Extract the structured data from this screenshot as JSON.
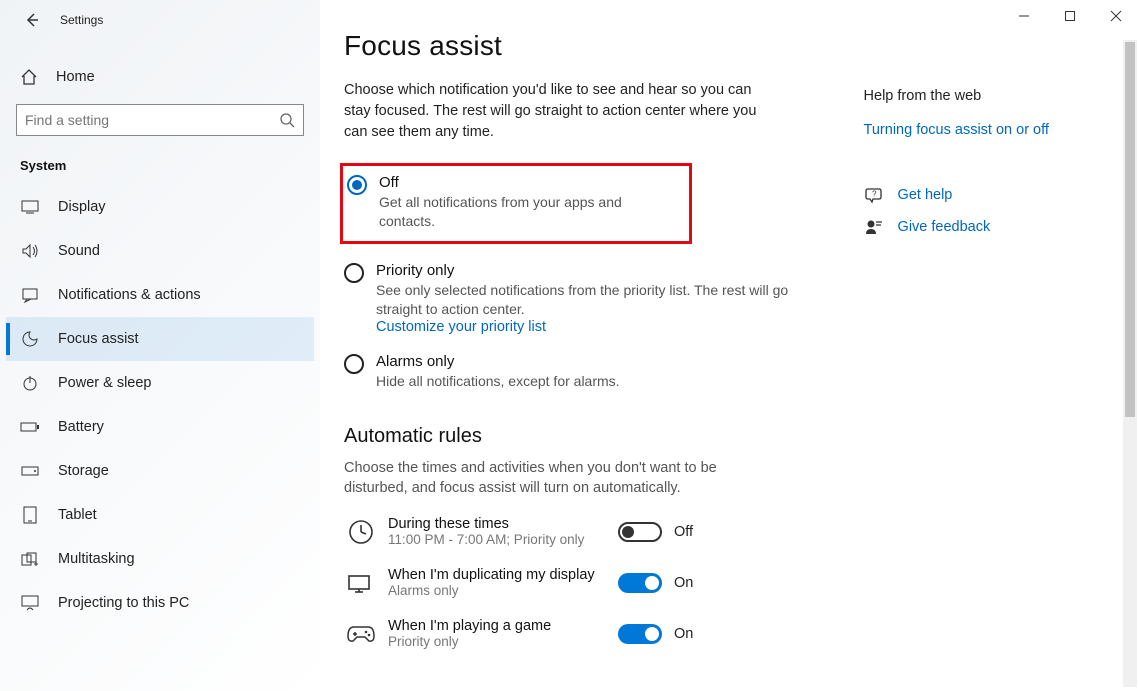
{
  "window": {
    "title": "Settings"
  },
  "sidebar": {
    "home": "Home",
    "search_placeholder": "Find a setting",
    "category": "System",
    "items": [
      {
        "label": "Display"
      },
      {
        "label": "Sound"
      },
      {
        "label": "Notifications & actions"
      },
      {
        "label": "Focus assist"
      },
      {
        "label": "Power & sleep"
      },
      {
        "label": "Battery"
      },
      {
        "label": "Storage"
      },
      {
        "label": "Tablet"
      },
      {
        "label": "Multitasking"
      },
      {
        "label": "Projecting to this PC"
      }
    ]
  },
  "page": {
    "title": "Focus assist",
    "description": "Choose which notification you'd like to see and hear so you can stay focused. The rest will go straight to action center where you can see them any time.",
    "options": {
      "off": {
        "label": "Off",
        "sub": "Get all notifications from your apps and contacts."
      },
      "priority": {
        "label": "Priority only",
        "sub": "See only selected notifications from the priority list. The rest will go straight to action center.",
        "link": "Customize your priority list"
      },
      "alarms": {
        "label": "Alarms only",
        "sub": "Hide all notifications, except for alarms."
      }
    },
    "rules": {
      "heading": "Automatic rules",
      "description": "Choose the times and activities when you don't want to be disturbed, and focus assist will turn on automatically.",
      "items": [
        {
          "title": "During these times",
          "sub": "11:00 PM - 7:00 AM; Priority only",
          "state": "Off",
          "on": false
        },
        {
          "title": "When I'm duplicating my display",
          "sub": "Alarms only",
          "state": "On",
          "on": true
        },
        {
          "title": "When I'm playing a game",
          "sub": "Priority only",
          "state": "On",
          "on": true
        }
      ]
    }
  },
  "aside": {
    "help_heading": "Help from the web",
    "help_link": "Turning focus assist on or off",
    "get_help": "Get help",
    "feedback": "Give feedback"
  }
}
